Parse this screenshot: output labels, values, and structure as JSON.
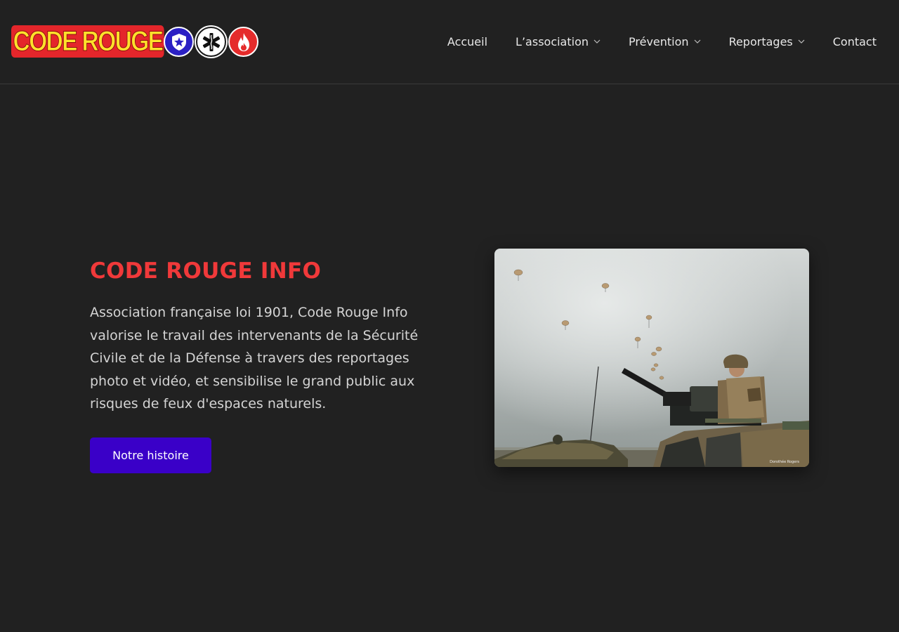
{
  "brand": {
    "logo_text": "CODE ROUGE",
    "badges": [
      {
        "name": "police-star-icon",
        "color": "#2b20c4"
      },
      {
        "name": "star-of-life-icon",
        "color": "#ffffff"
      },
      {
        "name": "fire-flame-icon",
        "color": "#e52b2b"
      }
    ]
  },
  "nav": {
    "items": [
      {
        "label": "Accueil",
        "dropdown": false
      },
      {
        "label": "L’association",
        "dropdown": true
      },
      {
        "label": "Prévention",
        "dropdown": true
      },
      {
        "label": "Reportages",
        "dropdown": true
      },
      {
        "label": "Contact",
        "dropdown": false
      }
    ]
  },
  "hero": {
    "title": "CODE ROUGE INFO",
    "description": "Association française loi 1901, Code Rouge Info valorise le travail des intervenants de la Sécurité Civile et de la Défense à travers des reportages photo et vidéo, et sensibilise le grand public aux risques de feux d'espaces naturels.",
    "cta_label": "Notre histoire",
    "image_credit": "Dorothée Rogers"
  },
  "colors": {
    "background": "#212121",
    "accent_red": "#f0393a",
    "cta_blue": "#3a00c8",
    "logo_yellow": "#ffe12b"
  }
}
